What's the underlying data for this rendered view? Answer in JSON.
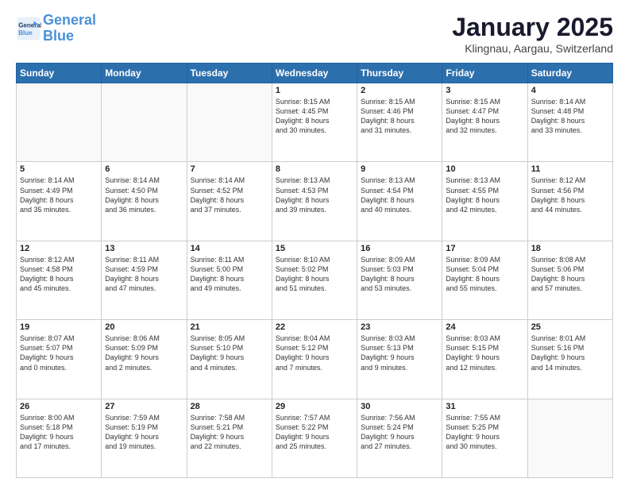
{
  "header": {
    "logo_line1": "General",
    "logo_line2": "Blue",
    "month": "January 2025",
    "location": "Klingnau, Aargau, Switzerland"
  },
  "weekdays": [
    "Sunday",
    "Monday",
    "Tuesday",
    "Wednesday",
    "Thursday",
    "Friday",
    "Saturday"
  ],
  "weeks": [
    [
      {
        "day": "",
        "info": ""
      },
      {
        "day": "",
        "info": ""
      },
      {
        "day": "",
        "info": ""
      },
      {
        "day": "1",
        "info": "Sunrise: 8:15 AM\nSunset: 4:45 PM\nDaylight: 8 hours\nand 30 minutes."
      },
      {
        "day": "2",
        "info": "Sunrise: 8:15 AM\nSunset: 4:46 PM\nDaylight: 8 hours\nand 31 minutes."
      },
      {
        "day": "3",
        "info": "Sunrise: 8:15 AM\nSunset: 4:47 PM\nDaylight: 8 hours\nand 32 minutes."
      },
      {
        "day": "4",
        "info": "Sunrise: 8:14 AM\nSunset: 4:48 PM\nDaylight: 8 hours\nand 33 minutes."
      }
    ],
    [
      {
        "day": "5",
        "info": "Sunrise: 8:14 AM\nSunset: 4:49 PM\nDaylight: 8 hours\nand 35 minutes."
      },
      {
        "day": "6",
        "info": "Sunrise: 8:14 AM\nSunset: 4:50 PM\nDaylight: 8 hours\nand 36 minutes."
      },
      {
        "day": "7",
        "info": "Sunrise: 8:14 AM\nSunset: 4:52 PM\nDaylight: 8 hours\nand 37 minutes."
      },
      {
        "day": "8",
        "info": "Sunrise: 8:13 AM\nSunset: 4:53 PM\nDaylight: 8 hours\nand 39 minutes."
      },
      {
        "day": "9",
        "info": "Sunrise: 8:13 AM\nSunset: 4:54 PM\nDaylight: 8 hours\nand 40 minutes."
      },
      {
        "day": "10",
        "info": "Sunrise: 8:13 AM\nSunset: 4:55 PM\nDaylight: 8 hours\nand 42 minutes."
      },
      {
        "day": "11",
        "info": "Sunrise: 8:12 AM\nSunset: 4:56 PM\nDaylight: 8 hours\nand 44 minutes."
      }
    ],
    [
      {
        "day": "12",
        "info": "Sunrise: 8:12 AM\nSunset: 4:58 PM\nDaylight: 8 hours\nand 45 minutes."
      },
      {
        "day": "13",
        "info": "Sunrise: 8:11 AM\nSunset: 4:59 PM\nDaylight: 8 hours\nand 47 minutes."
      },
      {
        "day": "14",
        "info": "Sunrise: 8:11 AM\nSunset: 5:00 PM\nDaylight: 8 hours\nand 49 minutes."
      },
      {
        "day": "15",
        "info": "Sunrise: 8:10 AM\nSunset: 5:02 PM\nDaylight: 8 hours\nand 51 minutes."
      },
      {
        "day": "16",
        "info": "Sunrise: 8:09 AM\nSunset: 5:03 PM\nDaylight: 8 hours\nand 53 minutes."
      },
      {
        "day": "17",
        "info": "Sunrise: 8:09 AM\nSunset: 5:04 PM\nDaylight: 8 hours\nand 55 minutes."
      },
      {
        "day": "18",
        "info": "Sunrise: 8:08 AM\nSunset: 5:06 PM\nDaylight: 8 hours\nand 57 minutes."
      }
    ],
    [
      {
        "day": "19",
        "info": "Sunrise: 8:07 AM\nSunset: 5:07 PM\nDaylight: 9 hours\nand 0 minutes."
      },
      {
        "day": "20",
        "info": "Sunrise: 8:06 AM\nSunset: 5:09 PM\nDaylight: 9 hours\nand 2 minutes."
      },
      {
        "day": "21",
        "info": "Sunrise: 8:05 AM\nSunset: 5:10 PM\nDaylight: 9 hours\nand 4 minutes."
      },
      {
        "day": "22",
        "info": "Sunrise: 8:04 AM\nSunset: 5:12 PM\nDaylight: 9 hours\nand 7 minutes."
      },
      {
        "day": "23",
        "info": "Sunrise: 8:03 AM\nSunset: 5:13 PM\nDaylight: 9 hours\nand 9 minutes."
      },
      {
        "day": "24",
        "info": "Sunrise: 8:03 AM\nSunset: 5:15 PM\nDaylight: 9 hours\nand 12 minutes."
      },
      {
        "day": "25",
        "info": "Sunrise: 8:01 AM\nSunset: 5:16 PM\nDaylight: 9 hours\nand 14 minutes."
      }
    ],
    [
      {
        "day": "26",
        "info": "Sunrise: 8:00 AM\nSunset: 5:18 PM\nDaylight: 9 hours\nand 17 minutes."
      },
      {
        "day": "27",
        "info": "Sunrise: 7:59 AM\nSunset: 5:19 PM\nDaylight: 9 hours\nand 19 minutes."
      },
      {
        "day": "28",
        "info": "Sunrise: 7:58 AM\nSunset: 5:21 PM\nDaylight: 9 hours\nand 22 minutes."
      },
      {
        "day": "29",
        "info": "Sunrise: 7:57 AM\nSunset: 5:22 PM\nDaylight: 9 hours\nand 25 minutes."
      },
      {
        "day": "30",
        "info": "Sunrise: 7:56 AM\nSunset: 5:24 PM\nDaylight: 9 hours\nand 27 minutes."
      },
      {
        "day": "31",
        "info": "Sunrise: 7:55 AM\nSunset: 5:25 PM\nDaylight: 9 hours\nand 30 minutes."
      },
      {
        "day": "",
        "info": ""
      }
    ]
  ]
}
